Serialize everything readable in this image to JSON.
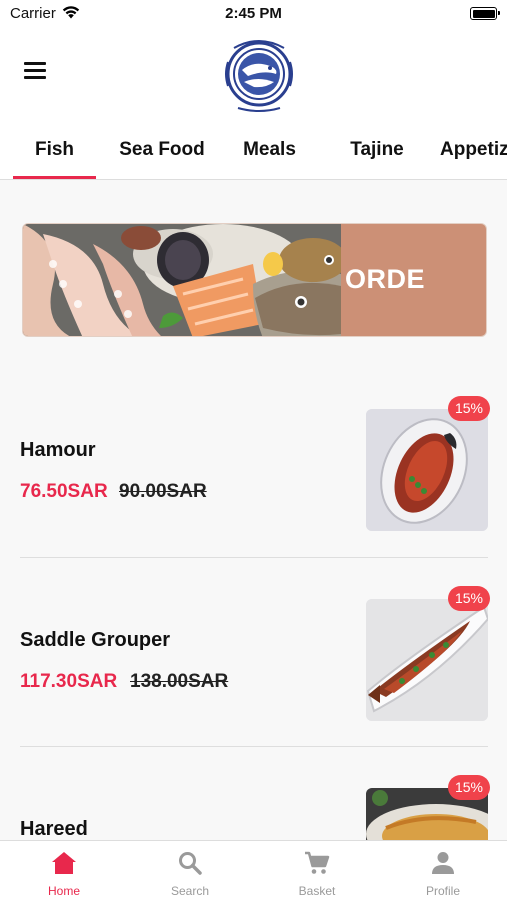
{
  "status_bar": {
    "carrier": "Carrier",
    "time": "2:45 PM"
  },
  "header": {
    "logo_icon": "restaurant-logo"
  },
  "tabs": [
    {
      "label": "Fish",
      "active": true
    },
    {
      "label": "Sea Food",
      "active": false
    },
    {
      "label": "Meals",
      "active": false
    },
    {
      "label": "Tajine",
      "active": false
    },
    {
      "label": "Appetiz",
      "active": false
    }
  ],
  "banner": {
    "text": "ORDE"
  },
  "items": [
    {
      "name": "Hamour",
      "price": "76.50SAR",
      "old_price": "90.00SAR",
      "discount": "15%"
    },
    {
      "name": "Saddle Grouper",
      "price": "117.30SAR",
      "old_price": "138.00SAR",
      "discount": "15%"
    },
    {
      "name": "Hareed",
      "discount": "15%"
    }
  ],
  "bottom_nav": [
    {
      "label": "Home",
      "icon": "home-icon",
      "active": true
    },
    {
      "label": "Search",
      "icon": "search-icon",
      "active": false
    },
    {
      "label": "Basket",
      "icon": "cart-icon",
      "active": false
    },
    {
      "label": "Profile",
      "icon": "profile-icon",
      "active": false
    }
  ],
  "colors": {
    "accent": "#e8284c",
    "badge": "#f0424b",
    "banner": "#cc9076"
  }
}
